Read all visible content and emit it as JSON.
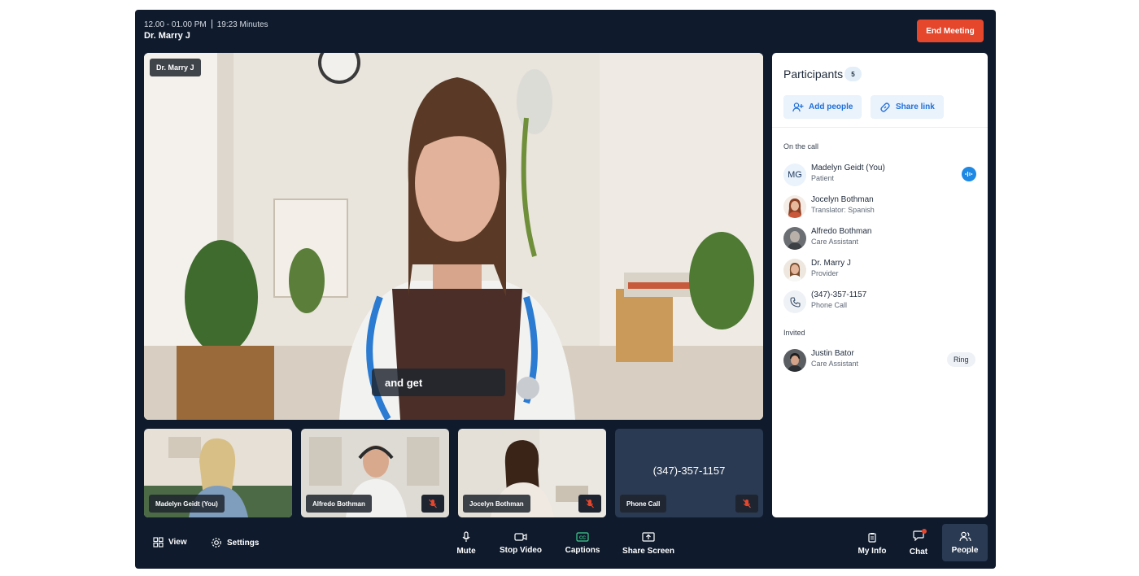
{
  "header": {
    "time_range": "12.00 - 01.00 PM",
    "duration": "19:23 Minutes",
    "host_name": "Dr. Marry J",
    "end_meeting_label": "End Meeting"
  },
  "main_video": {
    "speaker_tag": "Dr. Marry J",
    "caption_text": "and get"
  },
  "thumbnails": [
    {
      "name": "Madelyn Geidt (You)",
      "muted": false
    },
    {
      "name": "Alfredo Bothman",
      "muted": true
    },
    {
      "name": "Jocelyn Bothman",
      "muted": true
    },
    {
      "name": "Phone Call",
      "muted": true,
      "display_number": "(347)-357-1157"
    }
  ],
  "participants_panel": {
    "title": "Participants",
    "count": "5",
    "add_people_label": "Add people",
    "share_link_label": "Share link",
    "on_call_label": "On the call",
    "invited_label": "Invited",
    "on_call": [
      {
        "name": "Madelyn Geidt (You)",
        "role": "Patient",
        "initials": "MG",
        "speaking": true
      },
      {
        "name": "Jocelyn Bothman",
        "role": "Translator: Spanish"
      },
      {
        "name": "Alfredo Bothman",
        "role": "Care Assistant"
      },
      {
        "name": "Dr. Marry J",
        "role": "Provider"
      },
      {
        "name": "(347)-357-1157",
        "role": "Phone Call",
        "icon": "phone-icon"
      }
    ],
    "invited": [
      {
        "name": "Justin Bator",
        "role": "Care Assistant",
        "action_label": "Ring"
      }
    ]
  },
  "toolbar": {
    "view_label": "View",
    "settings_label": "Settings",
    "mute_label": "Mute",
    "stop_video_label": "Stop Video",
    "captions_label": "Captions",
    "share_screen_label": "Share Screen",
    "my_info_label": "My Info",
    "chat_label": "Chat",
    "people_label": "People"
  },
  "colors": {
    "app_background": "#0f1b2d",
    "end_meeting": "#e5472d",
    "accent_blue": "#1e6fd9",
    "captions_icon": "#3ecf8e"
  }
}
